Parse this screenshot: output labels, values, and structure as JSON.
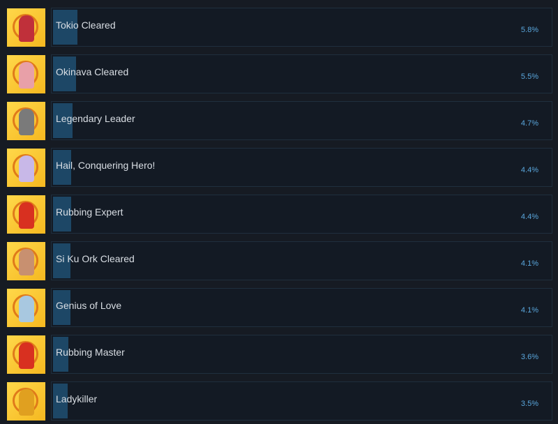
{
  "achievements": [
    {
      "name": "Tokio Cleared",
      "percent": "5.8%",
      "value": 5.8,
      "icon": "red-haired-girl-icon",
      "color": "#c0303a"
    },
    {
      "name": "Okinava Cleared",
      "percent": "5.5%",
      "value": 5.5,
      "icon": "pink-haired-girl-icon",
      "color": "#e8a0a8"
    },
    {
      "name": "Legendary Leader",
      "percent": "4.7%",
      "value": 4.7,
      "icon": "sword-shield-icon",
      "color": "#7a7a7a"
    },
    {
      "name": "Hail, Conquering Hero!",
      "percent": "4.4%",
      "value": 4.4,
      "icon": "white-haired-girl-icon",
      "color": "#c8b8e8"
    },
    {
      "name": "Rubbing Expert",
      "percent": "4.4%",
      "value": 4.4,
      "icon": "red-creature-icon",
      "color": "#d83020"
    },
    {
      "name": "Si Ku Ork Cleared",
      "percent": "4.1%",
      "value": 4.1,
      "icon": "brown-haired-girl-icon",
      "color": "#c89070"
    },
    {
      "name": "Genius of Love",
      "percent": "4.1%",
      "value": 4.1,
      "icon": "blue-creature-icon",
      "color": "#a8c8e0"
    },
    {
      "name": "Rubbing Master",
      "percent": "3.6%",
      "value": 3.6,
      "icon": "red-creature-icon",
      "color": "#d83020"
    },
    {
      "name": "Ladykiller",
      "percent": "3.5%",
      "value": 3.5,
      "icon": "crowned-creature-icon",
      "color": "#e0a020"
    }
  ]
}
